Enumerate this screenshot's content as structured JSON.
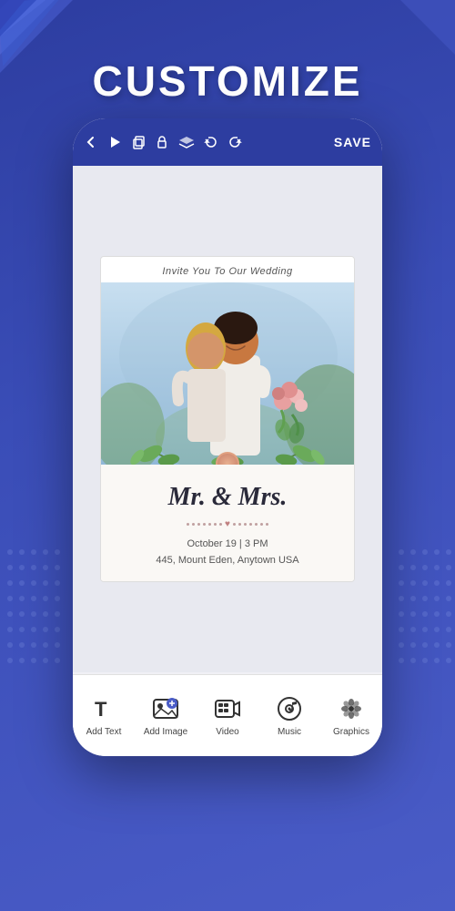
{
  "page": {
    "background_color": "#3a4db7",
    "heading": "CUSTOMIZE"
  },
  "toolbar": {
    "back_label": "‹",
    "save_label": "SAVE",
    "icons": [
      "▶",
      "▭",
      "🔓",
      "⧫",
      "↩",
      "↪"
    ]
  },
  "card": {
    "top_text": "Invite You To Our Wedding",
    "names": "Mr. & Mrs.",
    "date_line1": "October 19 | 3 PM",
    "date_line2": "445, Mount Eden, Anytown USA"
  },
  "bottom_nav": {
    "items": [
      {
        "id": "add-text",
        "label": "Add Text",
        "icon": "T"
      },
      {
        "id": "add-image",
        "label": "Add Image",
        "icon": "🖼"
      },
      {
        "id": "video",
        "label": "Video",
        "icon": "📹"
      },
      {
        "id": "music",
        "label": "Music",
        "icon": "🎵"
      },
      {
        "id": "graphics",
        "label": "Graphics",
        "icon": "✿"
      }
    ]
  }
}
